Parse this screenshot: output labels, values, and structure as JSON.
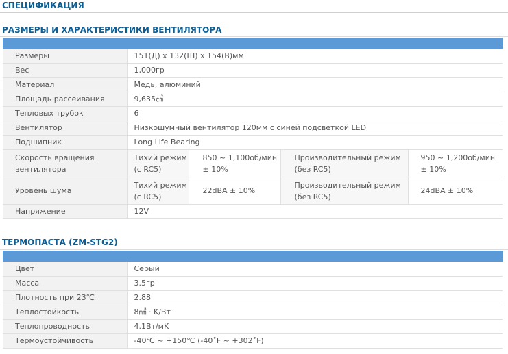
{
  "page": {
    "title": "СПЕЦИФИКАЦИЯ"
  },
  "fan_section": {
    "title": "РАЗМЕРЫ И ХАРАКТЕРИСТИКИ ВЕНТИЛЯТОРА",
    "rows": [
      {
        "label": "Размеры",
        "value": "151(Д) x 132(Ш) x 154(В)мм"
      },
      {
        "label": "Вес",
        "value": "1,000гр"
      },
      {
        "label": "Материал",
        "value": "Медь, алюминий"
      },
      {
        "label": "Площадь рассеивания",
        "value": "9,635㎠"
      },
      {
        "label": "Тепловых трубок",
        "value": "6"
      },
      {
        "label": "Вентилятор",
        "value": "Низкошумный вентилятор 120мм с синей подсветкой LED"
      },
      {
        "label": "Подшипник",
        "value": "Long Life Bearing"
      }
    ],
    "speed": {
      "label": "Скорость вращения вентилятора",
      "quiet_mode": "Тихий режим (с RC5)",
      "quiet_value": "850 ~ 1,100об/мин ± 10%",
      "perf_mode": "Производительный режим (без RC5)",
      "perf_value": "950 ~ 1,200об/мин ± 10%"
    },
    "noise": {
      "label": "Уровень шума",
      "quiet_mode": "Тихий режим (с RC5)",
      "quiet_value": "22dBA ± 10%",
      "perf_mode": "Производительный режим (без RC5)",
      "perf_value": "24dBA ± 10%"
    },
    "voltage": {
      "label": "Напряжение",
      "value": "12V"
    }
  },
  "paste_section": {
    "title": "ТЕРМОПАСТА (ZM-STG2)",
    "rows": [
      {
        "label": "Цвет",
        "value": "Серый"
      },
      {
        "label": "Масса",
        "value": "3.5гр"
      },
      {
        "label": "Плотность при 23℃",
        "value": "2.88"
      },
      {
        "label": "Теплостойкость",
        "value": "8㎟ · K/Вт"
      },
      {
        "label": "Теплопроводность",
        "value": "4.1Вт/мK"
      },
      {
        "label": "Термоустойчивость",
        "value": "-40℃ ~ +150℃ (-40˚F ~ +302˚F)"
      }
    ]
  },
  "colors": {
    "heading": "#0b5f96",
    "header_bar": "#5b9ad6",
    "label_bg": "#f2f2f2",
    "text": "#555555"
  }
}
